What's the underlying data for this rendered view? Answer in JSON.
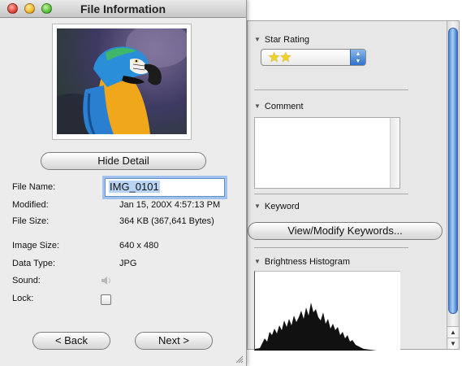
{
  "window": {
    "title": "File Information"
  },
  "preview": {
    "alt": "parrot-photo"
  },
  "buttons": {
    "hide_detail": "Hide Detail",
    "back": "< Back",
    "next": "Next >"
  },
  "fields": {
    "file_name_label": "File Name:",
    "file_name_value": "IMG_0101",
    "modified_label": "Modified:",
    "modified_value": "Jan 15, 200X 4:57:13 PM",
    "file_size_label": "File Size:",
    "file_size_value": "364 KB (367,641 Bytes)",
    "image_size_label": "Image Size:",
    "image_size_value": "640 x 480",
    "data_type_label": "Data Type:",
    "data_type_value": "JPG",
    "sound_label": "Sound:",
    "lock_label": "Lock:"
  },
  "detail": {
    "star_rating_label": "Star Rating",
    "star_rating_value": "★★",
    "star_rating_count": 2,
    "comment_label": "Comment",
    "comment_value": "",
    "keyword_label": "Keyword",
    "keywords_button": "View/Modify Keywords...",
    "histogram_label": "Brightness Histogram"
  },
  "icons": {
    "sound": "speaker-icon",
    "lock": "checkbox",
    "collapse": "disclosure-triangle-icon"
  },
  "colors": {
    "focus_ring": "#9fc3ee",
    "selection": "#b9d4f3",
    "star": "#f2d21c",
    "scroll_thumb": "#4f86d9"
  }
}
